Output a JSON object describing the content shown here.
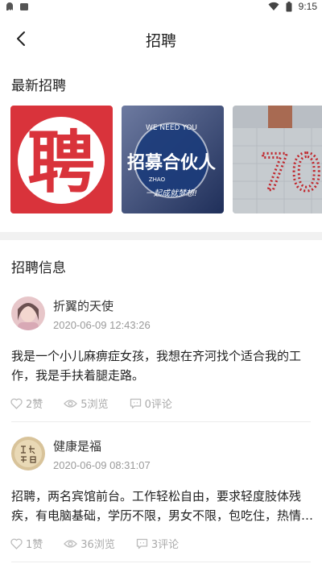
{
  "status": {
    "time": "9:15"
  },
  "header": {
    "title": "招聘"
  },
  "sections": {
    "latest": "最新招聘",
    "info": "招聘信息"
  },
  "banners": [
    {
      "name": "recruit-banner-pin",
      "char": "聘",
      "color": "#d9333b"
    },
    {
      "name": "recruit-banner-partner",
      "headline": "招募合伙人",
      "top_text": "WE NEED YOU",
      "sub_text": "一起成就梦想!",
      "tag": "ZHAO"
    },
    {
      "name": "recruit-banner-crowd",
      "text": "70"
    }
  ],
  "posts": [
    {
      "user": "折翼的天使",
      "time": "2020-06-09 12:43:26",
      "text": "我是一个小儿麻痹症女孩，我想在齐河找个适合我的工作，我是手扶着腿走路。",
      "likes": "2赞",
      "views": "5浏览",
      "comments": "0评论"
    },
    {
      "user": "健康是福",
      "time": "2020-06-09 08:31:07",
      "text": "招聘，两名宾馆前台。工作轻松自由，要求轻度肢体残疾，有电脑基础，学历不限，男女不限，包吃住，热情，有责任心。",
      "likes": "1赞",
      "views": "36浏览",
      "comments": "3评论"
    }
  ]
}
